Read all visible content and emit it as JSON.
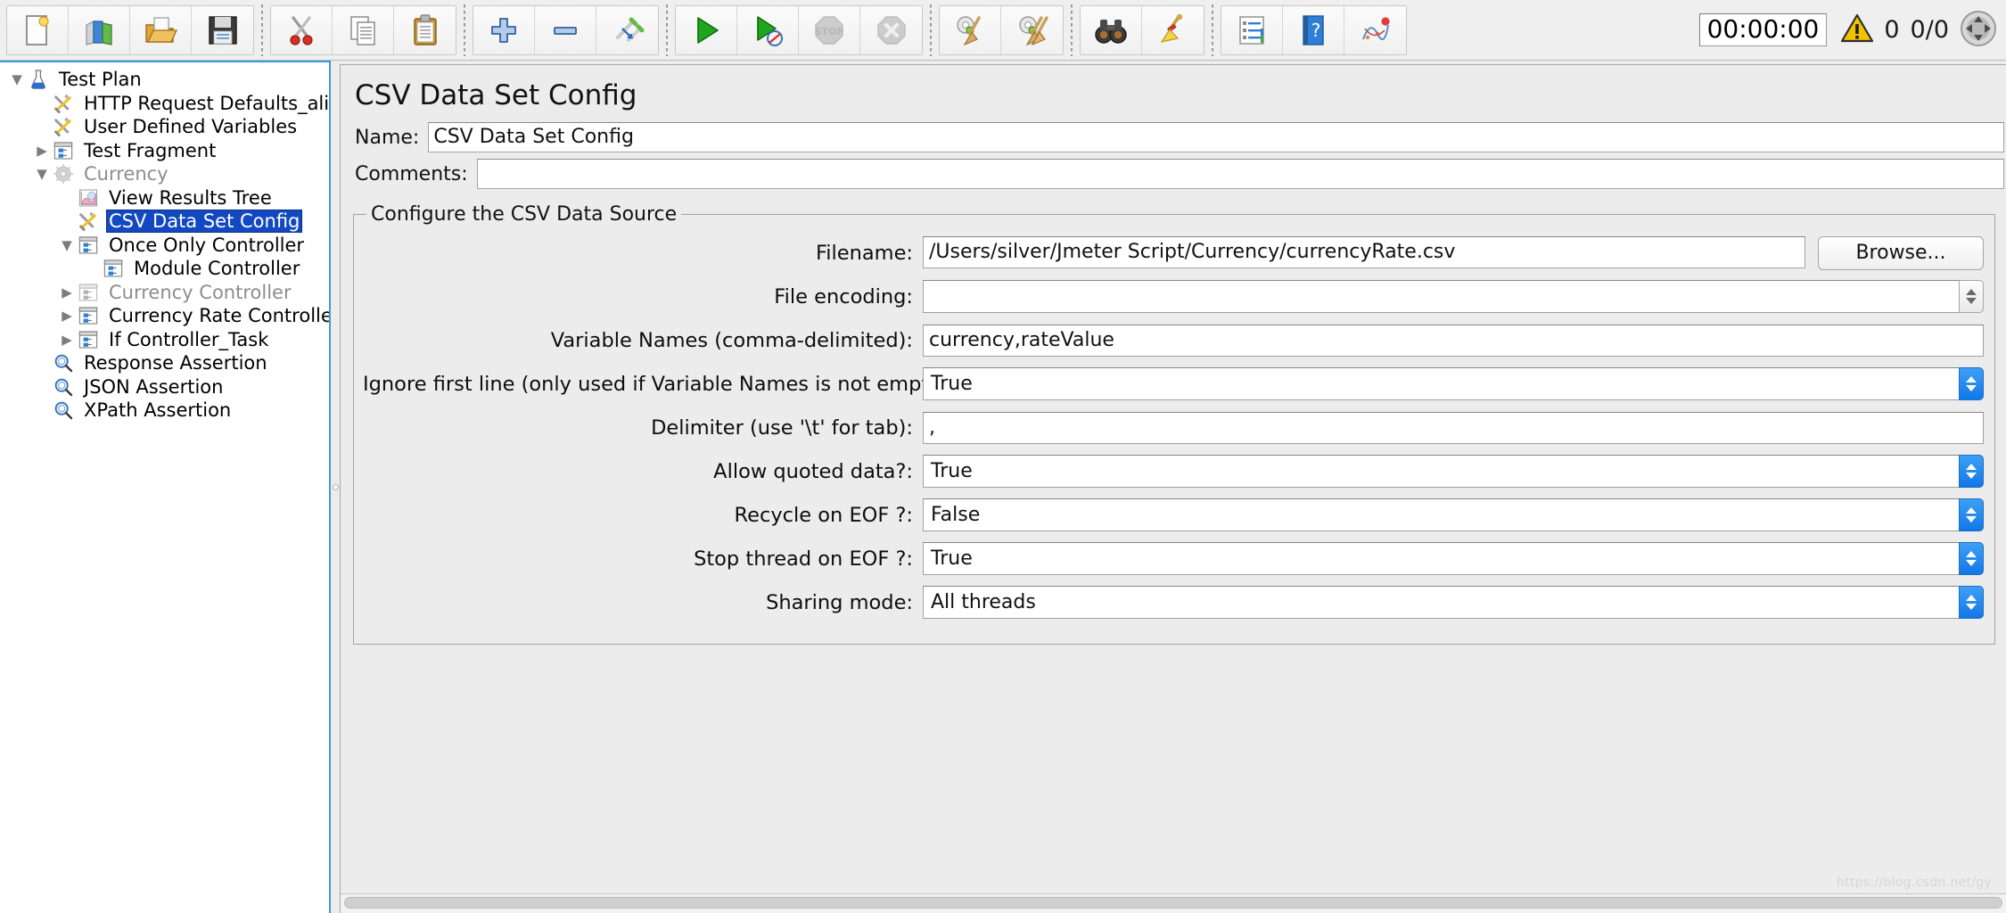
{
  "toolbar": {
    "groups": [
      {
        "name": "file-group",
        "buttons": [
          {
            "name": "new-button",
            "icon": "new-document-icon",
            "tooltip": "New",
            "disabled": false
          },
          {
            "name": "templates-button",
            "icon": "templates-folders-icon",
            "tooltip": "Templates",
            "disabled": false
          },
          {
            "name": "open-button",
            "icon": "open-folder-icon",
            "tooltip": "Open",
            "disabled": false
          },
          {
            "name": "save-button",
            "icon": "floppy-disk-icon",
            "tooltip": "Save Test Plan",
            "disabled": false
          }
        ]
      },
      {
        "name": "clipboard-group",
        "buttons": [
          {
            "name": "cut-button",
            "icon": "scissors-icon",
            "tooltip": "Cut",
            "disabled": false
          },
          {
            "name": "copy-button",
            "icon": "copy-pages-icon",
            "tooltip": "Copy",
            "disabled": false
          },
          {
            "name": "paste-button",
            "icon": "clipboard-icon",
            "tooltip": "Paste",
            "disabled": false
          }
        ]
      },
      {
        "name": "expand-group",
        "buttons": [
          {
            "name": "expand-all-button",
            "icon": "plus-icon",
            "tooltip": "Expand All",
            "disabled": false
          },
          {
            "name": "collapse-all-button",
            "icon": "minus-icon",
            "tooltip": "Collapse All",
            "disabled": false
          },
          {
            "name": "toggle-button",
            "icon": "toggle-pencils-icon",
            "tooltip": "Toggle",
            "disabled": false
          }
        ]
      },
      {
        "name": "run-group",
        "buttons": [
          {
            "name": "start-button",
            "icon": "play-triangle-icon",
            "tooltip": "Start",
            "disabled": false
          },
          {
            "name": "start-no-pauses-button",
            "icon": "play-no-pauses-icon",
            "tooltip": "Start no pauses",
            "disabled": false
          },
          {
            "name": "stop-button",
            "icon": "stop-sign-icon",
            "tooltip": "Stop",
            "disabled": true
          },
          {
            "name": "shutdown-button",
            "icon": "shutdown-x-icon",
            "tooltip": "Shutdown",
            "disabled": true
          }
        ]
      },
      {
        "name": "clear-group",
        "buttons": [
          {
            "name": "clear-button",
            "icon": "gear-broom-icon",
            "tooltip": "Clear",
            "disabled": false
          },
          {
            "name": "clear-all-button",
            "icon": "gear-brooms-icon",
            "tooltip": "Clear All",
            "disabled": false
          }
        ]
      },
      {
        "name": "search-group",
        "buttons": [
          {
            "name": "search-button",
            "icon": "binoculars-icon",
            "tooltip": "Search",
            "disabled": false
          },
          {
            "name": "reset-search-button",
            "icon": "yellow-broom-icon",
            "tooltip": "Reset Search",
            "disabled": false
          }
        ]
      },
      {
        "name": "help-group",
        "buttons": [
          {
            "name": "function-helper-button",
            "icon": "list-lines-icon",
            "tooltip": "Function Helper Dialog",
            "disabled": false
          },
          {
            "name": "help-button",
            "icon": "blue-book-question-icon",
            "tooltip": "Help",
            "disabled": false
          },
          {
            "name": "undo-redo-button",
            "icon": "scribble-red-dot-icon",
            "tooltip": "Undo",
            "disabled": false
          }
        ]
      }
    ],
    "timer": "00:00:00",
    "warning_icon": "warning-triangle-icon",
    "warning_count": "0",
    "thread_counts": "0/0",
    "remote_icon": "four-arrows-circle-icon"
  },
  "tree": {
    "nodes": [
      {
        "label": "Test Plan",
        "icon": "flask-icon",
        "indent": 0,
        "twisty": "down",
        "disabled": false,
        "selected": false
      },
      {
        "label": "HTTP Request Defaults_aliyunRDS",
        "icon": "wrench-screwdriver-icon",
        "indent": 1,
        "twisty": "none",
        "disabled": false,
        "selected": false
      },
      {
        "label": "User Defined Variables",
        "icon": "wrench-screwdriver-icon",
        "indent": 1,
        "twisty": "none",
        "disabled": false,
        "selected": false
      },
      {
        "label": "Test Fragment",
        "icon": "controller-window-icon",
        "indent": 1,
        "twisty": "right",
        "disabled": false,
        "selected": false
      },
      {
        "label": "Currency",
        "icon": "gear-icon",
        "indent": 1,
        "twisty": "down",
        "disabled": true,
        "selected": false
      },
      {
        "label": "View Results Tree",
        "icon": "results-chart-icon",
        "indent": 2,
        "twisty": "none",
        "disabled": false,
        "selected": false
      },
      {
        "label": "CSV Data Set Config",
        "icon": "wrench-screwdriver-icon",
        "indent": 2,
        "twisty": "none",
        "disabled": false,
        "selected": true
      },
      {
        "label": "Once Only Controller",
        "icon": "controller-window-icon",
        "indent": 2,
        "twisty": "down",
        "disabled": false,
        "selected": false
      },
      {
        "label": "Module Controller",
        "icon": "controller-window-icon",
        "indent": 3,
        "twisty": "none",
        "disabled": false,
        "selected": false
      },
      {
        "label": "Currency Controller",
        "icon": "controller-window-icon",
        "indent": 2,
        "twisty": "right",
        "disabled": true,
        "selected": false
      },
      {
        "label": "Currency Rate Controller",
        "icon": "controller-window-icon",
        "indent": 2,
        "twisty": "right",
        "disabled": false,
        "selected": false
      },
      {
        "label": "If Controller_Task",
        "icon": "controller-window-icon",
        "indent": 2,
        "twisty": "right",
        "disabled": false,
        "selected": false
      },
      {
        "label": "Response Assertion",
        "icon": "magnifier-icon",
        "indent": 1,
        "twisty": "none",
        "disabled": false,
        "selected": false
      },
      {
        "label": "JSON Assertion",
        "icon": "magnifier-icon",
        "indent": 1,
        "twisty": "none",
        "disabled": false,
        "selected": false
      },
      {
        "label": "XPath Assertion",
        "icon": "magnifier-icon",
        "indent": 1,
        "twisty": "none",
        "disabled": false,
        "selected": false
      }
    ]
  },
  "panel": {
    "title": "CSV Data Set Config",
    "name_label": "Name:",
    "name_value": "CSV Data Set Config",
    "comments_label": "Comments:",
    "comments_value": "",
    "group_legend": "Configure the CSV Data Source",
    "browse_label": "Browse...",
    "fields": [
      {
        "label": "Filename:",
        "value": "/Users/silver/Jmeter Script/Currency/currencyRate.csv",
        "kind": "text-with-browse"
      },
      {
        "label": "File encoding:",
        "value": "",
        "kind": "combo-plain"
      },
      {
        "label": "Variable Names (comma-delimited):",
        "value": "currency,rateValue",
        "kind": "text"
      },
      {
        "label": "Ignore first line (only used if Variable Names is not empty):",
        "value": "True",
        "kind": "combo-blue"
      },
      {
        "label": "Delimiter (use '\\t' for tab):",
        "value": ",",
        "kind": "text"
      },
      {
        "label": "Allow quoted data?:",
        "value": "True",
        "kind": "combo-blue"
      },
      {
        "label": "Recycle on EOF ?:",
        "value": "False",
        "kind": "combo-blue"
      },
      {
        "label": "Stop thread on EOF ?:",
        "value": "True",
        "kind": "combo-blue"
      },
      {
        "label": "Sharing mode:",
        "value": "All threads",
        "kind": "combo-blue"
      }
    ]
  },
  "watermark": "https://blog.csdn.net/gy",
  "colors": {
    "selection_blue": "#1249c2",
    "spinner_blue": "#1277e8",
    "panel_bg": "#ececec",
    "focus_border": "#3b9bdd"
  }
}
